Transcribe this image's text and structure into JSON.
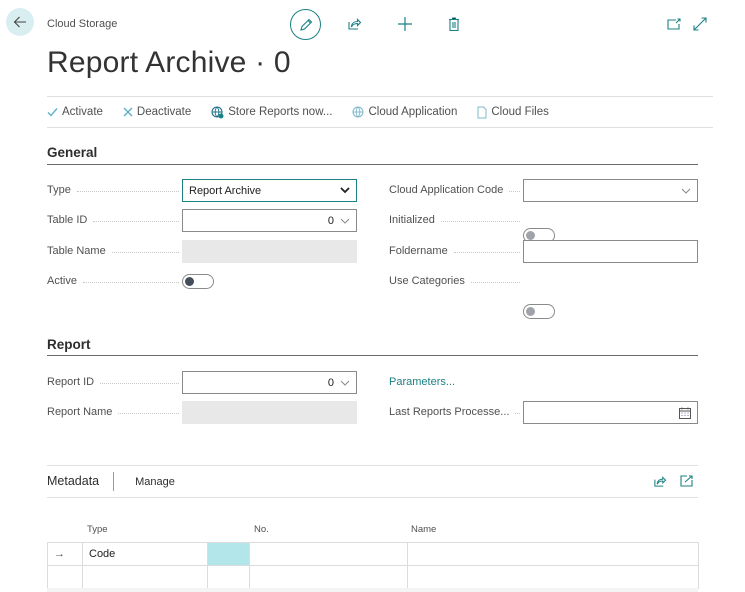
{
  "header": {
    "breadcrumb": "Cloud Storage",
    "title": "Report Archive · 0",
    "icons": [
      "back-arrow-icon",
      "pencil-icon",
      "share-icon",
      "plus-icon",
      "trash-icon",
      "open-new-window-icon",
      "expand-icon"
    ]
  },
  "actions": [
    {
      "label": "Activate",
      "icon": "check-icon"
    },
    {
      "label": "Deactivate",
      "icon": "x-icon"
    },
    {
      "label": "Store Reports now...",
      "icon": "globe-sync-icon"
    },
    {
      "label": "Cloud Application",
      "icon": "globe-icon"
    },
    {
      "label": "Cloud Files",
      "icon": "document-icon"
    }
  ],
  "general": {
    "title": "General",
    "type_label": "Type",
    "type_value": "Report Archive",
    "table_id_label": "Table ID",
    "table_id_value": "0",
    "table_name_label": "Table Name",
    "table_name_value": "",
    "active_label": "Active",
    "active_value": false,
    "cloud_app_code_label": "Cloud Application Code",
    "cloud_app_code_value": "",
    "initialized_label": "Initialized",
    "initialized_value": false,
    "foldername_label": "Foldername",
    "foldername_value": "",
    "use_categories_label": "Use Categories",
    "use_categories_value": false
  },
  "report": {
    "title": "Report",
    "report_id_label": "Report ID",
    "report_id_value": "0",
    "report_name_label": "Report Name",
    "report_name_value": "",
    "parameters_link": "Parameters...",
    "last_processed_label": "Last Reports Processe...",
    "last_processed_value": ""
  },
  "metadata": {
    "title": "Metadata",
    "manage_label": "Manage",
    "columns": [
      "Type",
      "No.",
      "Name"
    ],
    "rows": [
      {
        "indicator": "→",
        "type": "Code",
        "no": "",
        "name": ""
      },
      {
        "indicator": "",
        "type": "",
        "no": "",
        "name": ""
      }
    ],
    "accent_color": "#b3e6eb"
  },
  "colors": {
    "accent": "#1c8184",
    "text": "#212121",
    "muted": "#505050"
  }
}
